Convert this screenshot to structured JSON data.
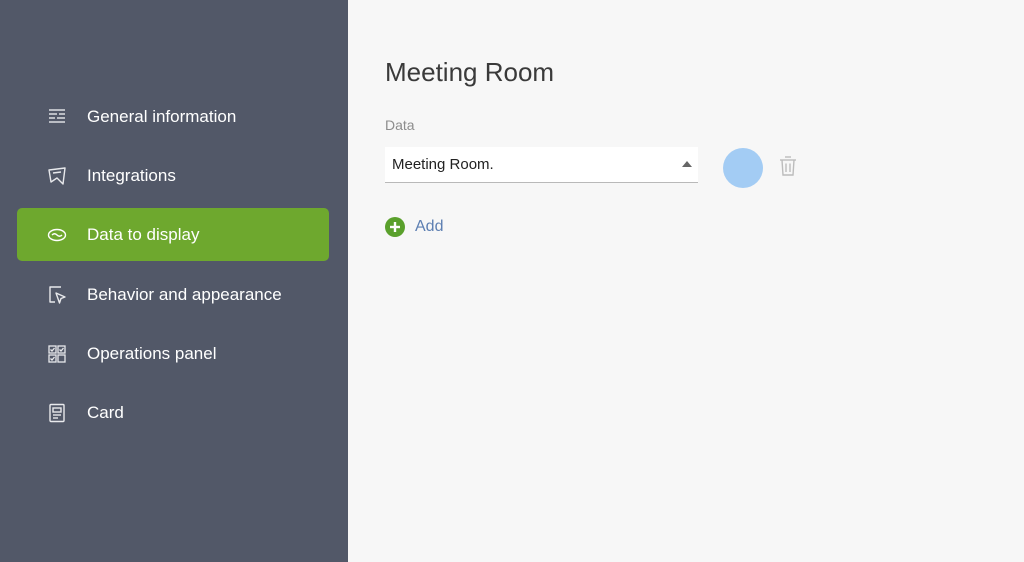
{
  "sidebar": {
    "items": [
      {
        "label": "General information",
        "icon": "list-lines-icon",
        "active": false
      },
      {
        "label": "Integrations",
        "icon": "map-pin-icon",
        "active": false
      },
      {
        "label": "Data to display",
        "icon": "eye-icon",
        "active": true
      },
      {
        "label": "Behavior and appearance",
        "icon": "cursor-icon",
        "active": false
      },
      {
        "label": "Operations panel",
        "icon": "grid-check-icon",
        "active": false
      },
      {
        "label": "Card",
        "icon": "card-icon",
        "active": false
      }
    ]
  },
  "main": {
    "title": "Meeting Room",
    "field_label": "Data",
    "select_value": "Meeting Room.",
    "color": "#a3ccf4",
    "add_label": "Add"
  },
  "colors": {
    "sidebar_bg": "#525868",
    "active_bg": "#6ea82e",
    "accent_green": "#5aa02c",
    "link_blue": "#5d7fb2"
  }
}
